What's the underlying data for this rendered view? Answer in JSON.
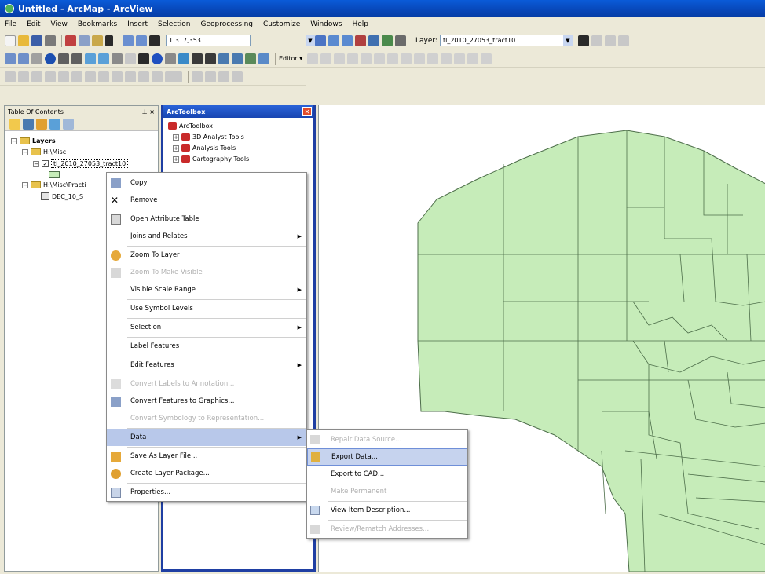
{
  "window": {
    "title": "Untitled - ArcMap - ArcView"
  },
  "menubar": {
    "items": [
      "File",
      "Edit",
      "View",
      "Bookmarks",
      "Insert",
      "Selection",
      "Geoprocessing",
      "Customize",
      "Windows",
      "Help"
    ]
  },
  "toolbar": {
    "scale": "1:317,353",
    "layer_label": "Layer:",
    "layer_value": "tl_2010_27053_tract10",
    "editor_label": "Editor ▾"
  },
  "toc": {
    "title": "Table Of Contents",
    "pin": "⊥ ×",
    "layers": "Layers",
    "folder1": "H:\\Misc",
    "layer1": "tl_2010_27053_tract10",
    "folder2": "H:\\Misc\\Practi",
    "layer2": "DEC_10_S"
  },
  "toolbox": {
    "title": "ArcToolbox",
    "root": "ArcToolbox",
    "items": [
      "3D Analyst Tools",
      "Analysis Tools",
      "Cartography Tools"
    ]
  },
  "context_menu": {
    "copy": "Copy",
    "remove": "Remove",
    "open_attribute_table": "Open Attribute Table",
    "joins_relates": "Joins and Relates",
    "zoom_to_layer": "Zoom To Layer",
    "zoom_to_visible": "Zoom To Make Visible",
    "visible_scale_range": "Visible Scale Range",
    "use_symbol_levels": "Use Symbol Levels",
    "selection": "Selection",
    "label_features": "Label Features",
    "edit_features": "Edit Features",
    "convert_labels": "Convert Labels to Annotation...",
    "convert_features": "Convert Features to Graphics...",
    "convert_symbology": "Convert Symbology to Representation...",
    "data": "Data",
    "save_as_layer": "Save As Layer File...",
    "create_package": "Create Layer Package...",
    "properties": "Properties..."
  },
  "data_submenu": {
    "repair": "Repair Data Source...",
    "export_data": "Export Data...",
    "export_cad": "Export to CAD...",
    "make_permanent": "Make Permanent",
    "view_item": "View Item Description...",
    "review_rematch": "Review/Rematch Addresses..."
  },
  "colors": {
    "map_fill": "#c6ecb9",
    "map_stroke": "#4d6e4a",
    "highlight": "#b8c8ea"
  }
}
